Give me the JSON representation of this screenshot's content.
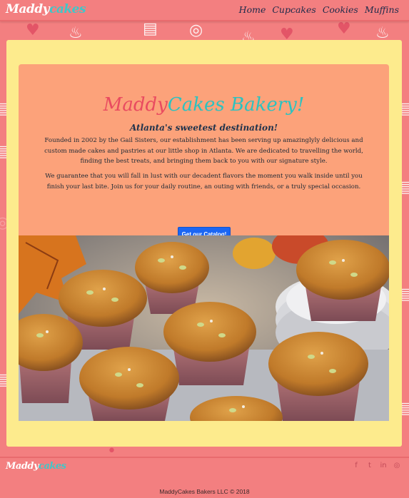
{
  "navbar": {
    "brand_part1": "Maddy",
    "brand_part2": "cakes",
    "links": [
      "Home",
      "Cupcakes",
      "Cookies",
      "Muffins"
    ]
  },
  "hero": {
    "title_part1": "Maddy",
    "title_part2": "Cakes Bakery!",
    "subtitle": "Atlanta's sweetest destination!",
    "paragraph1": "Founded in 2002 by the Gail Sisters, our establishment has been serving up amazinglyly delicious and custom made cakes and pastries at our little shop in Atlanta. We are dedicated to travelling the world, finding the best treats, and bringing them back to you with our signature style.",
    "paragraph2": "We guarantee that you will fall in lust with our decadent flavors the moment you walk inside until you finish your last bite. Join us for your daily routine, an outing with friends, or a truly special occasion.",
    "button_label": "Get our Catalog!"
  },
  "footer": {
    "brand_part1": "Maddy",
    "brand_part2": "cakes",
    "social_icons": [
      "facebook-icon",
      "twitter-icon",
      "linkedin-icon",
      "instagram-icon"
    ],
    "copyright": "MaddyCakes Bakers LLC © 2018"
  },
  "colors": {
    "page_background": "#f37f80",
    "card_background": "#fdeb8d",
    "jumbotron_background": "#fca27a",
    "brand_teal": "#3fc7c9",
    "brand_pink": "#e94b60",
    "button_blue": "#1b66f3"
  }
}
